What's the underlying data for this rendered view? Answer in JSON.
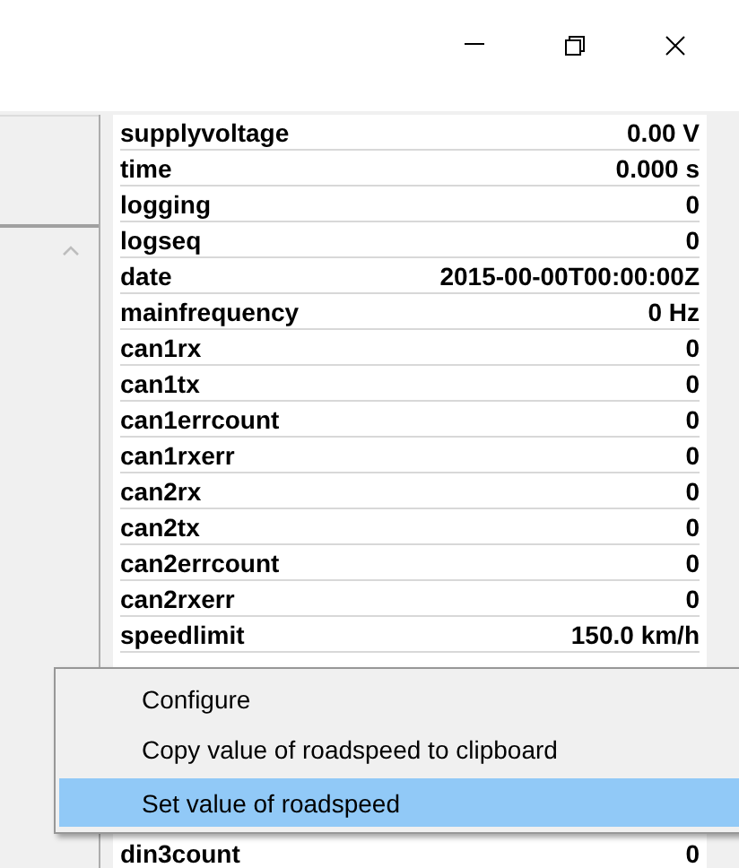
{
  "window": {
    "controls": [
      {
        "kind": "minimize"
      },
      {
        "kind": "restore"
      },
      {
        "kind": "close"
      }
    ]
  },
  "table": {
    "rows": [
      {
        "name": "supplyvoltage",
        "value": "0.00 V"
      },
      {
        "name": "time",
        "value": "0.000 s"
      },
      {
        "name": "logging",
        "value": "0"
      },
      {
        "name": "logseq",
        "value": "0"
      },
      {
        "name": "date",
        "value": "2015-00-00T00:00:00Z"
      },
      {
        "name": "mainfrequency",
        "value": "0 Hz"
      },
      {
        "name": "can1rx",
        "value": "0"
      },
      {
        "name": "can1tx",
        "value": "0"
      },
      {
        "name": "can1errcount",
        "value": "0"
      },
      {
        "name": "can1rxerr",
        "value": "0"
      },
      {
        "name": "can2rx",
        "value": "0"
      },
      {
        "name": "can2tx",
        "value": "0"
      },
      {
        "name": "can2errcount",
        "value": "0"
      },
      {
        "name": "can2rxerr",
        "value": "0"
      },
      {
        "name": "speedlimit",
        "value": "150.0 km/h"
      }
    ],
    "rows_after_menu": [
      {
        "name": "din3count",
        "value": "0"
      }
    ]
  },
  "context_menu": {
    "items": [
      {
        "label": "Configure",
        "selected": false
      },
      {
        "label": "Copy value of roadspeed to clipboard",
        "selected": false
      },
      {
        "label": "Set value of roadspeed",
        "selected": true
      }
    ]
  }
}
